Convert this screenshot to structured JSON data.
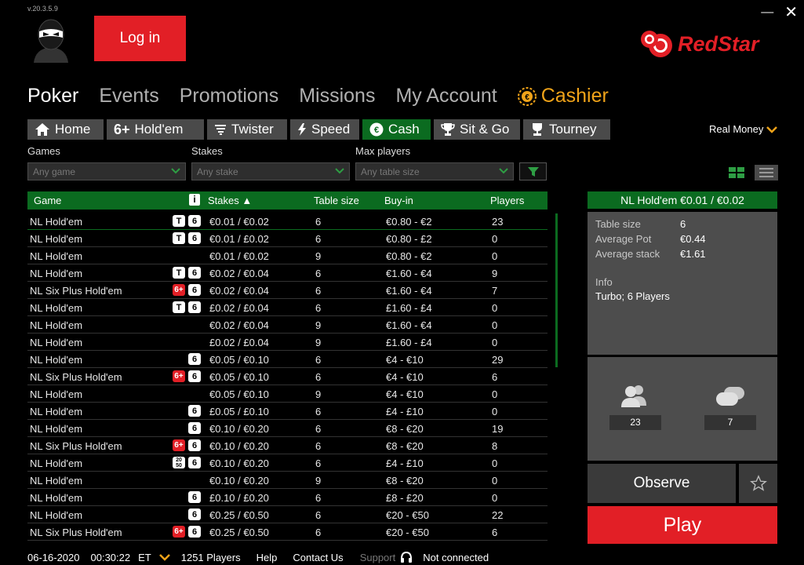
{
  "app": {
    "version": "v.20.3.5.9",
    "close_glyph": "✕",
    "minimize_glyph": "—",
    "login_label": "Log in",
    "brand_name": "RedStar",
    "brand_color": "#e21f26"
  },
  "main_nav": [
    {
      "label": "Poker",
      "active": true
    },
    {
      "label": "Events"
    },
    {
      "label": "Promotions"
    },
    {
      "label": "Missions"
    },
    {
      "label": "My Account"
    },
    {
      "label": "Cashier",
      "icon": "euro-coin-icon",
      "color": "#f0a319"
    }
  ],
  "sub_tabs": [
    {
      "label": "Home",
      "icon": "home-icon"
    },
    {
      "label": "Hold'em",
      "icon": "six-plus-icon",
      "icon_text": "6+"
    },
    {
      "label": "Twister",
      "icon": "tornado-icon"
    },
    {
      "label": "Speed",
      "icon": "lightning-icon"
    },
    {
      "label": "Cash",
      "icon": "euro-icon",
      "active": true
    },
    {
      "label": "Sit & Go",
      "icon": "trophy-icon"
    },
    {
      "label": "Tourney",
      "icon": "cup-icon"
    }
  ],
  "money_mode": "Real Money",
  "filters": {
    "games_label": "Games",
    "games_placeholder": "Any game",
    "stakes_label": "Stakes",
    "stakes_placeholder": "Any stake",
    "max_players_label": "Max players",
    "max_players_placeholder": "Any table size"
  },
  "table": {
    "headers": {
      "game": "Game",
      "info": "i",
      "stakes": "Stakes ▲",
      "table_size": "Table size",
      "buy_in": "Buy-in",
      "players": "Players"
    },
    "rows": [
      {
        "game": "NL Hold'em",
        "b1": "T",
        "b2": "6",
        "stakes": "€0.01 / €0.02",
        "size": "6",
        "buyin": "€0.80 - €2",
        "players": "23"
      },
      {
        "game": "NL Hold'em",
        "b1": "T",
        "b2": "6",
        "stakes": "€0.01 / £0.02",
        "size": "6",
        "buyin": "€0.80 - £2",
        "players": "0"
      },
      {
        "game": "NL Hold'em",
        "stakes": "€0.01 / €0.02",
        "size": "9",
        "buyin": "€0.80 - €2",
        "players": "0"
      },
      {
        "game": "NL Hold'em",
        "b1": "T",
        "b2": "6",
        "stakes": "€0.02 / €0.04",
        "size": "6",
        "buyin": "€1.60 - €4",
        "players": "9"
      },
      {
        "game": "NL Six Plus Hold'em",
        "b1r": "6+",
        "b2": "6",
        "stakes": "€0.02 / €0.04",
        "size": "6",
        "buyin": "€1.60 - €4",
        "players": "7"
      },
      {
        "game": "NL Hold'em",
        "b1": "T",
        "b2": "6",
        "stakes": "£0.02 / £0.04",
        "size": "6",
        "buyin": "£1.60 - £4",
        "players": "0"
      },
      {
        "game": "NL Hold'em",
        "stakes": "€0.02 / €0.04",
        "size": "9",
        "buyin": "€1.60 - €4",
        "players": "0"
      },
      {
        "game": "NL Hold'em",
        "stakes": "£0.02 / £0.04",
        "size": "9",
        "buyin": "£1.60 - £4",
        "players": "0"
      },
      {
        "game": "NL Hold'em",
        "b2": "6",
        "stakes": "€0.05 / €0.10",
        "size": "6",
        "buyin": "€4 - €10",
        "players": "29"
      },
      {
        "game": "NL Six Plus Hold'em",
        "b1r": "6+",
        "b2": "6",
        "stakes": "€0.05 / €0.10",
        "size": "6",
        "buyin": "€4 - €10",
        "players": "6"
      },
      {
        "game": "NL Hold'em",
        "stakes": "€0.05 / €0.10",
        "size": "9",
        "buyin": "€4 - €10",
        "players": "0"
      },
      {
        "game": "NL Hold'em",
        "b2": "6",
        "stakes": "£0.05 / £0.10",
        "size": "6",
        "buyin": "£4 - £10",
        "players": "0"
      },
      {
        "game": "NL Hold'em",
        "b2": "6",
        "stakes": "€0.10 / €0.20",
        "size": "6",
        "buyin": "€8 - €20",
        "players": "19"
      },
      {
        "game": "NL Six Plus Hold'em",
        "b1r": "6+",
        "b2": "6",
        "stakes": "€0.10 / €0.20",
        "size": "6",
        "buyin": "€8 - €20",
        "players": "8"
      },
      {
        "game": "NL Hold'em",
        "b1t": [
          "20",
          "50"
        ],
        "b2": "6",
        "stakes": "€0.10 / €0.20",
        "size": "6",
        "buyin": "£4 - £10",
        "players": "0"
      },
      {
        "game": "NL Hold'em",
        "stakes": "€0.10 / €0.20",
        "size": "9",
        "buyin": "€8 - €20",
        "players": "0"
      },
      {
        "game": "NL Hold'em",
        "b2": "6",
        "stakes": "£0.10 / £0.20",
        "size": "6",
        "buyin": "£8 - £20",
        "players": "0"
      },
      {
        "game": "NL Hold'em",
        "b2": "6",
        "stakes": "€0.25 / €0.50",
        "size": "6",
        "buyin": "€20 - €50",
        "players": "22"
      },
      {
        "game": "NL Six Plus Hold'em",
        "b1r": "6+",
        "b2": "6",
        "stakes": "€0.25 / €0.50",
        "size": "6",
        "buyin": "€20 - €50",
        "players": "6"
      }
    ]
  },
  "panel": {
    "title": "NL Hold'em €0.01 / €0.02",
    "table_size_label": "Table size",
    "table_size_value": "6",
    "avg_pot_label": "Average Pot",
    "avg_pot_value": "€0.44",
    "avg_stack_label": "Average stack",
    "avg_stack_value": "€1.61",
    "info_label": "Info",
    "info_value": "Turbo; 6 Players",
    "players_count": "23",
    "tables_count": "7",
    "observe_label": "Observe",
    "play_label": "Play"
  },
  "status": {
    "date": "06-16-2020",
    "time": "00:30:22",
    "tz": "ET",
    "players": "1251 Players",
    "help": "Help",
    "contact": "Contact Us",
    "support": "Support",
    "connection": "Not connected"
  }
}
